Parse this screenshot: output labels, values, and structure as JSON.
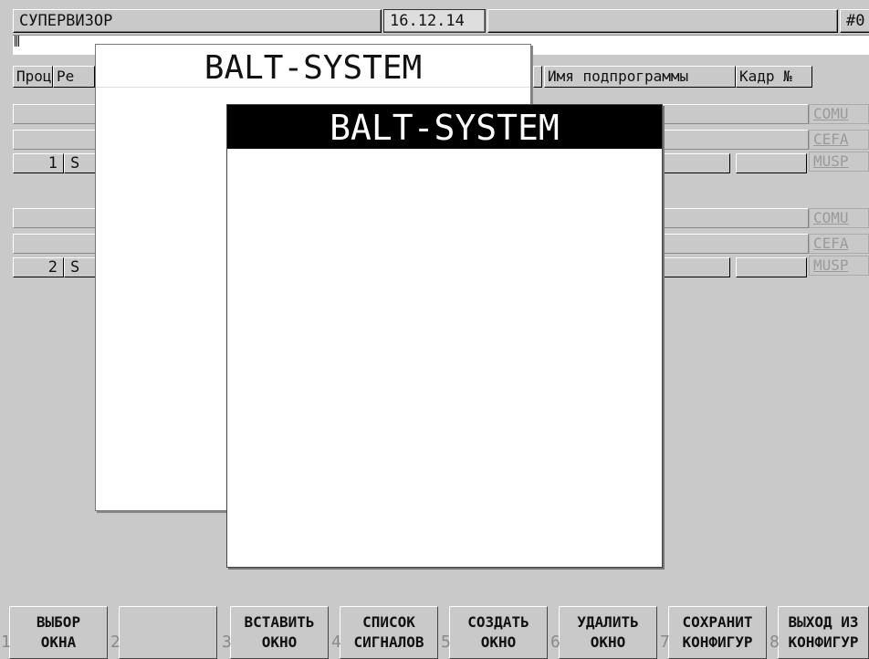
{
  "header": {
    "title": "СУПЕРВИЗОР",
    "date": "16.12.14",
    "id": "#0"
  },
  "columns": {
    "proc": "Проц",
    "re": "Ре",
    "subprogram": "Имя подпрограммы",
    "frame": "Кадр №"
  },
  "panels": [
    {
      "num": "1",
      "s": "S",
      "signals": [
        "COMU",
        "CEFA",
        "MUSP"
      ]
    },
    {
      "num": "2",
      "s": "S",
      "signals": [
        "COMU",
        "CEFA",
        "MUSP"
      ]
    }
  ],
  "windows": {
    "back_title": "BALT-SYSTEM",
    "front_title": "BALT-SYSTEM"
  },
  "softkeys": [
    {
      "num": "1",
      "label": "ВЫБОР\nОКНА"
    },
    {
      "num": "2",
      "label": ""
    },
    {
      "num": "3",
      "label": "ВСТАВИТЬ\nОКНО"
    },
    {
      "num": "4",
      "label": "СПИСОК\nСИГНАЛОВ"
    },
    {
      "num": "5",
      "label": "СОЗДАТЬ\nОКНО"
    },
    {
      "num": "6",
      "label": "УДАЛИТЬ\nОКНО"
    },
    {
      "num": "7",
      "label": "СОХРАНИТ\nКОНФИГУР"
    },
    {
      "num": "8",
      "label": "ВЫХОД ИЗ\nКОНФИГУР"
    }
  ]
}
